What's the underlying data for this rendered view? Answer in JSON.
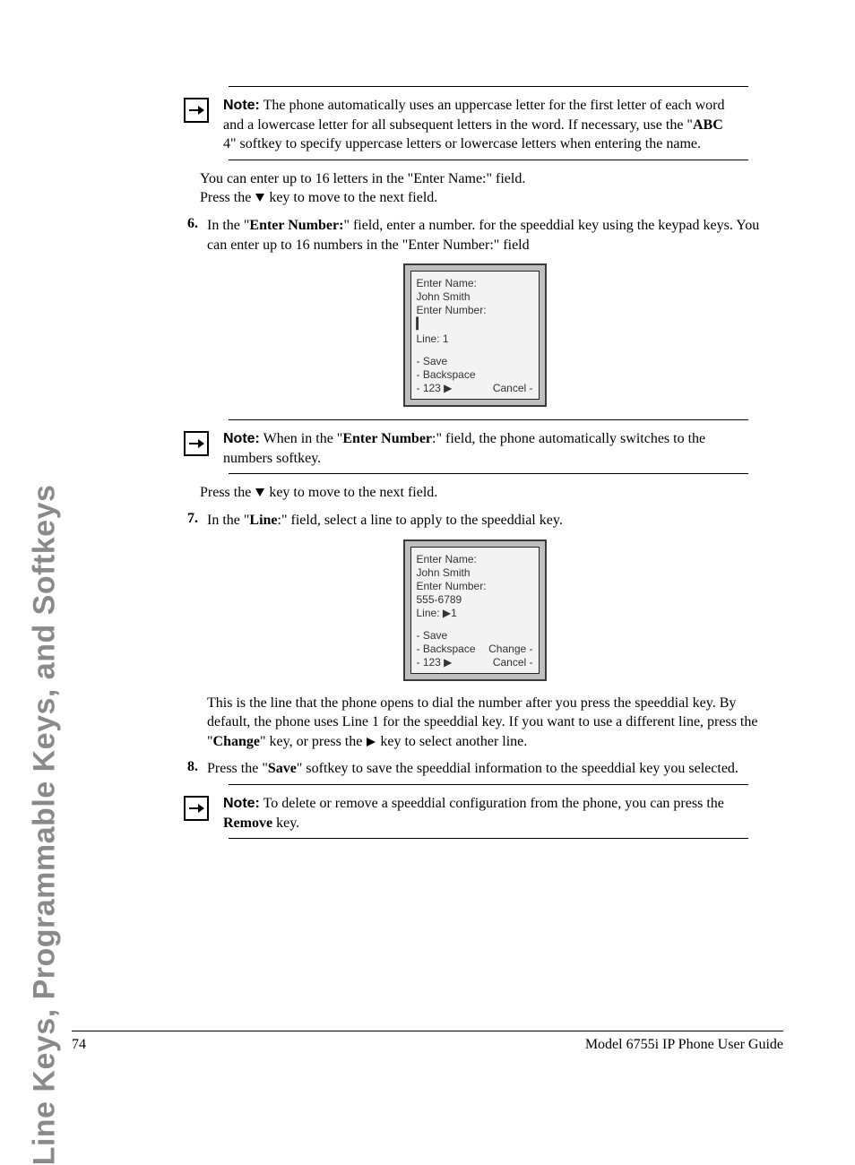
{
  "sideTitle": "Line Keys, Programmable Keys, and Softkeys",
  "note1": {
    "label": "Note:",
    "text_a": " The phone automatically uses an uppercase letter for the first letter of each word and a lowercase letter for all subsequent letters in the word. If necessary, use the \"",
    "bold_a": "ABC",
    "text_b": " 4\" softkey to specify uppercase letters or lowercase letters when entering the name."
  },
  "para1": "You can enter up to 16 letters in the \"Enter Name:\" field.",
  "para2_a": "Press the ",
  "para2_b": " key to move to the next field.",
  "step6": {
    "num": "6.",
    "a": "In the \"",
    "b": "Enter Number:",
    "c": "\" field, enter a number. for the speeddial key using the keypad keys. You can enter up to 16 numbers in the \"Enter Number:\" field"
  },
  "lcd1": {
    "l1": "Enter Name:",
    "l2": "John Smith",
    "l3": "Enter Number:",
    "cursor": "▎",
    "l5": "Line: 1",
    "s1": "- Save",
    "s2": "- Backspace",
    "s3": "- 123 ▶",
    "s4": "Cancel -"
  },
  "note2": {
    "label": "Note:",
    "a": " When in the \"",
    "b": "Enter Number",
    "c": ":\" field, the phone automatically switches to the numbers softkey."
  },
  "para3_a": "Press the ",
  "para3_b": " key to move to the next field.",
  "step7": {
    "num": "7.",
    "a": "In the \"",
    "b": "Line",
    "c": ":\" field, select a line to apply to the speeddial key."
  },
  "lcd2": {
    "l1": "Enter Name:",
    "l2": "John Smith",
    "l3": "Enter Number:",
    "l4": "555-6789",
    "l5": "Line: ▶1",
    "s1": "- Save",
    "s2": "- Backspace",
    "s3": "- 123 ▶",
    "r1": "Change -",
    "r2": "Cancel -"
  },
  "para4_a": "This is the line that the phone opens to dial the number after you press the speeddial key. By default, the phone uses Line 1 for the speeddial key. If you want to use a different line, press the \"",
  "para4_b": "Change",
  "para4_c": "\" key, or press the ",
  "para4_d": " key to select another line.",
  "step8": {
    "num": "8.",
    "a": "Press the \"",
    "b": "Save",
    "c": "\" softkey to save the speeddial information to the speeddial key you selected."
  },
  "note3": {
    "label": "Note:",
    "a": " To delete or remove a speeddial configuration from the phone, you can press the ",
    "b": "Remove",
    "c": " key."
  },
  "footer": {
    "page": "74",
    "title": "Model 6755i IP Phone User Guide"
  }
}
